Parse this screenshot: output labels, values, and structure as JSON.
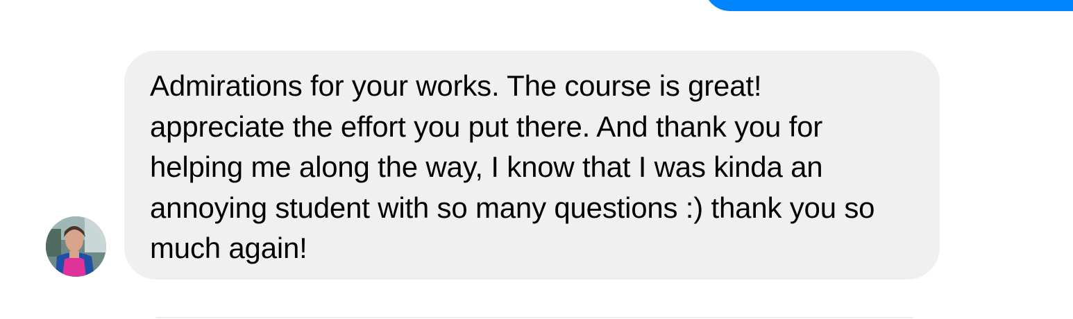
{
  "conversation": {
    "sent_message": {
      "color": "#0084ff"
    },
    "received_message": {
      "avatar_icon": "user-photo-avatar",
      "bubble_color": "#f0f0f0",
      "text": "Admirations for your works. The course is great!\nappreciate the effort you put there. And thank you for\nhelping me along the way, I know that I was kinda an\nannoying student with so many questions :) thank you so\nmuch again!"
    }
  }
}
